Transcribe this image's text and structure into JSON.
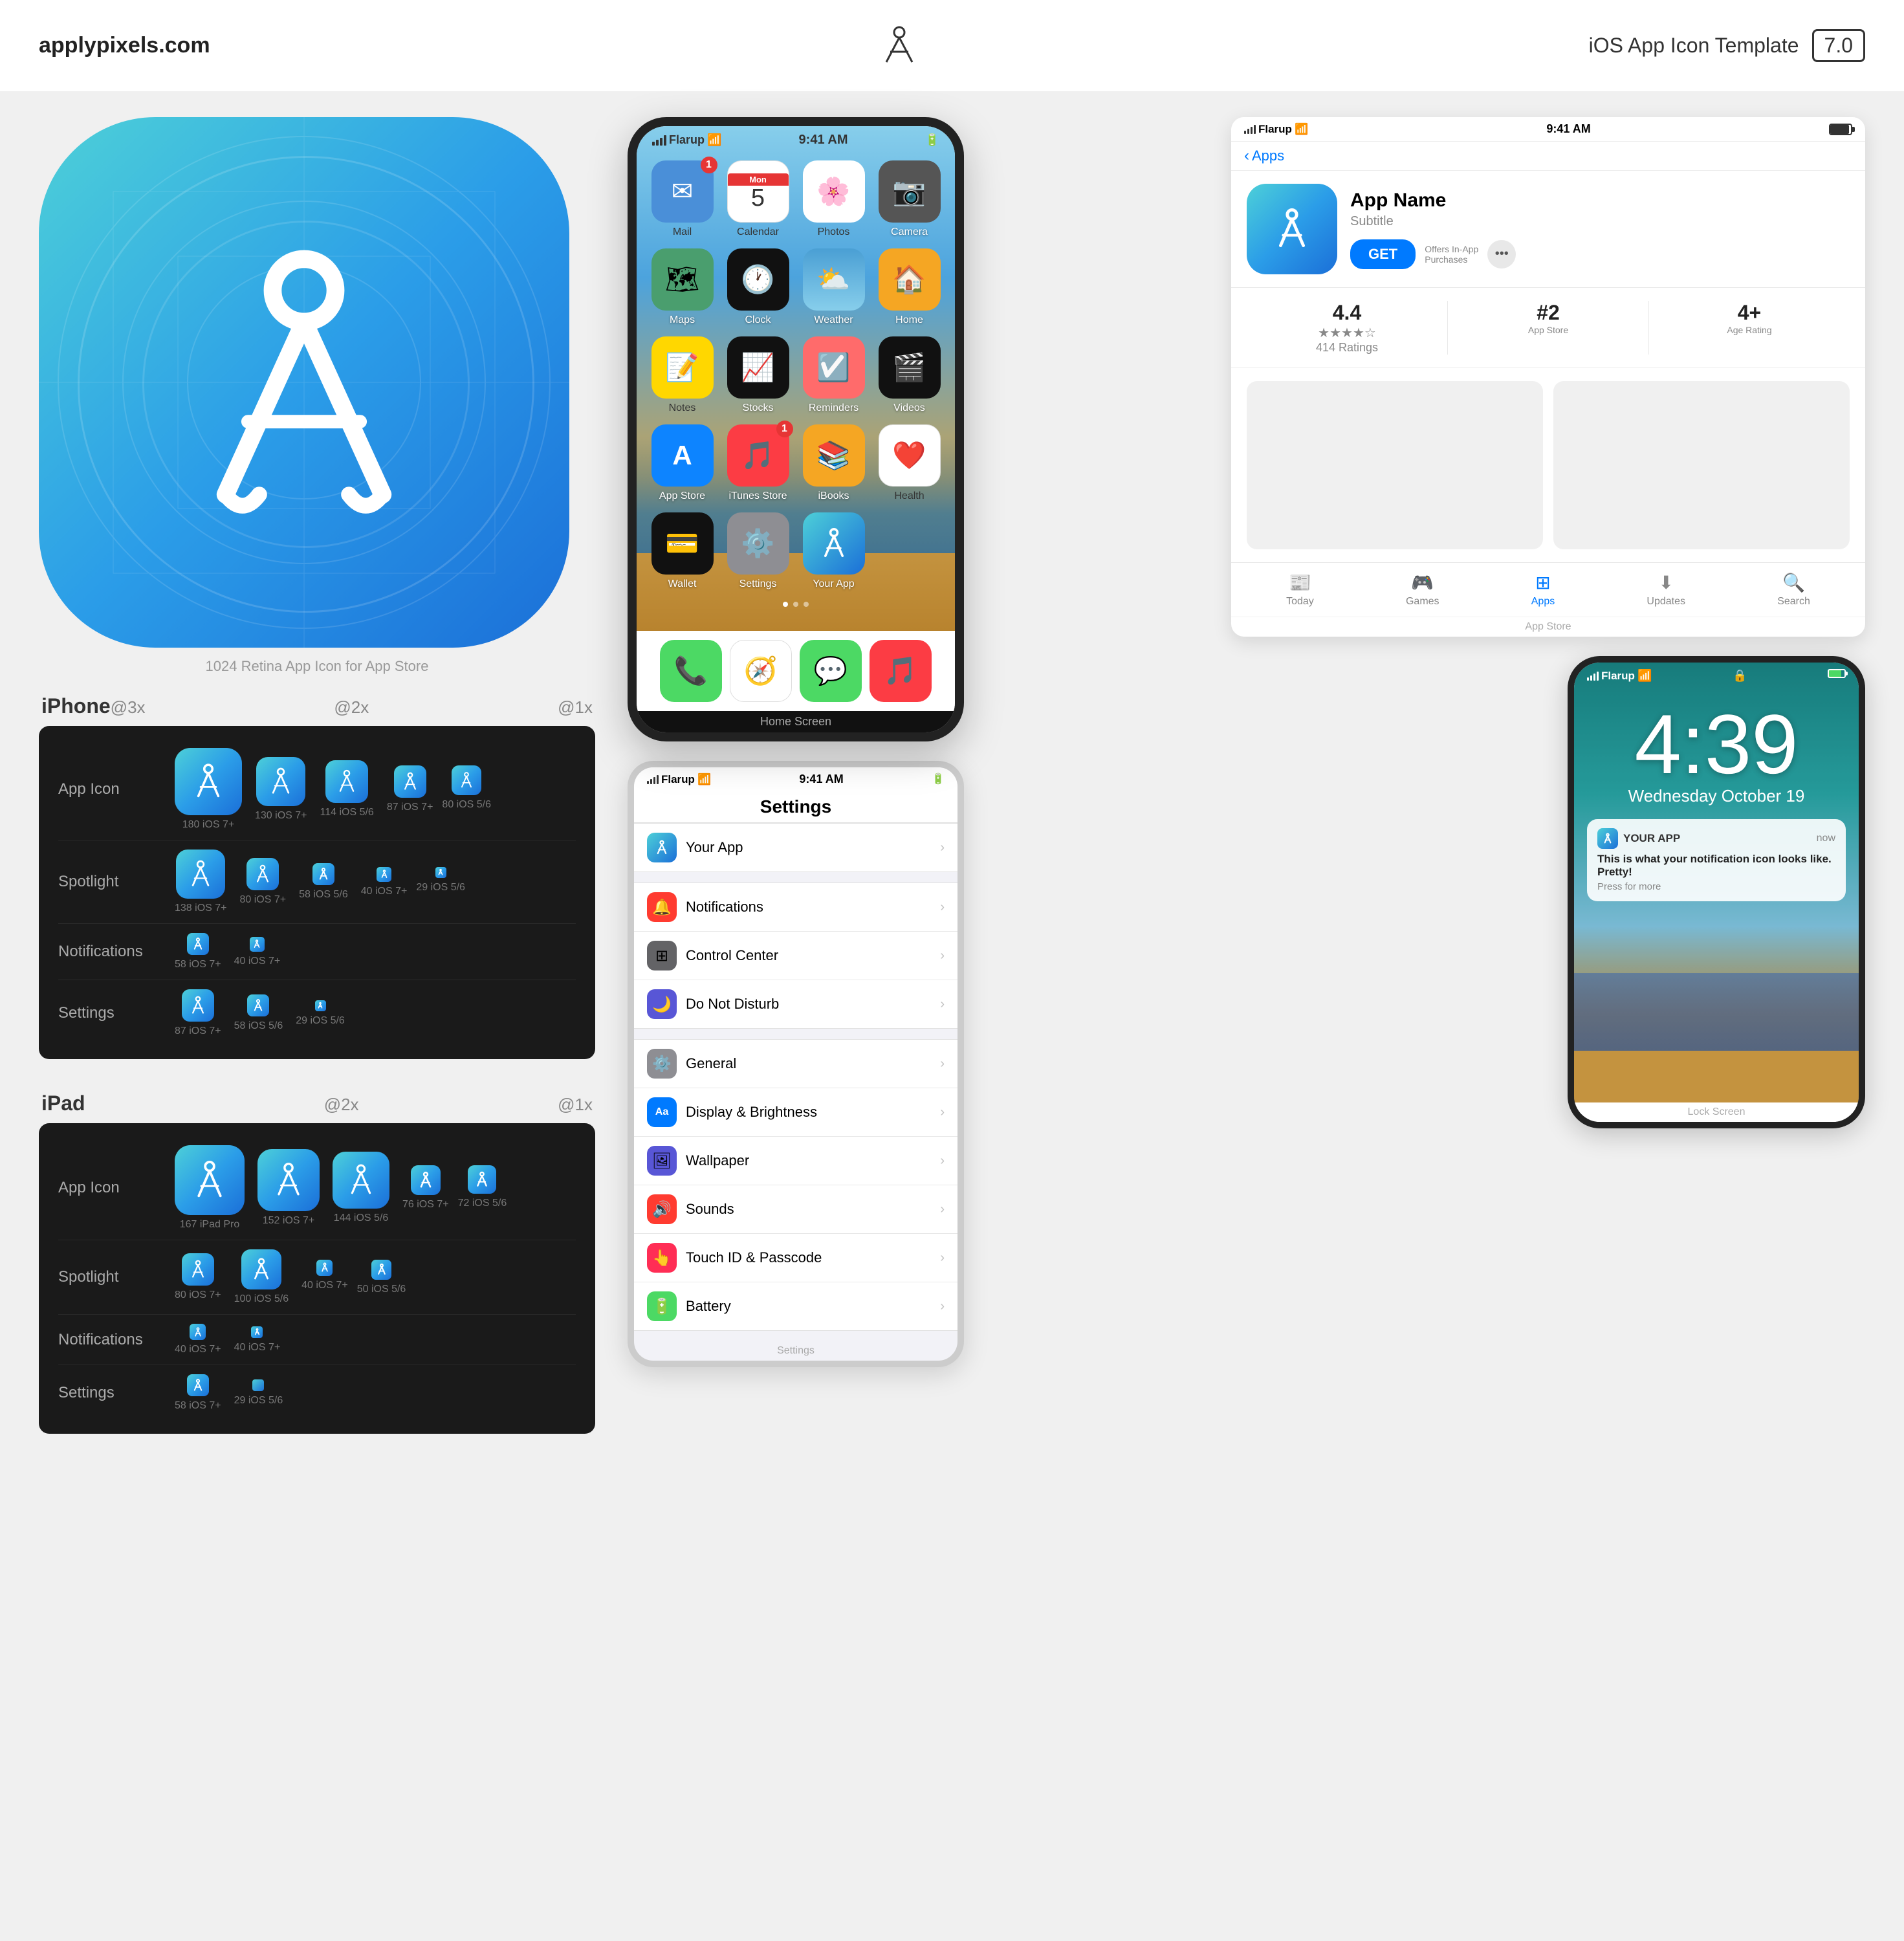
{
  "header": {
    "site": "applypixels.com",
    "template_label": "iOS App Icon Template",
    "version": "7.0"
  },
  "large_icon_label": "1024 Retina App Icon for App Store",
  "iphone": {
    "title": "iPhone",
    "scales": {
      "s3x": "@3x",
      "s2x": "@2x",
      "s1x": "@1x"
    },
    "rows": [
      {
        "label": "App Icon",
        "items": [
          {
            "size": 180,
            "label": "180 iOS 7+",
            "scale": "3x"
          },
          {
            "size": 130,
            "label": "130 iOS 7+",
            "scale": "2x"
          },
          {
            "size": 114,
            "label": "114 iOS 5/6",
            "scale": "2x"
          },
          {
            "size": 87,
            "label": "87 iOS 7+",
            "scale": "1x"
          },
          {
            "size": 80,
            "label": "80 iOS 5/6",
            "scale": "1x"
          }
        ]
      },
      {
        "label": "Spotlight",
        "items": [
          {
            "size": 138,
            "label": "138 iOS 7+",
            "scale": "3x"
          },
          {
            "size": 80,
            "label": "80 iOS 7+",
            "scale": "2x"
          },
          {
            "size": 58,
            "label": "58 iOS 5/6",
            "scale": "2x"
          },
          {
            "size": 40,
            "label": "40 iOS 7+",
            "scale": "1x"
          },
          {
            "size": 29,
            "label": "29 iOS 5/6",
            "scale": "1x"
          }
        ]
      },
      {
        "label": "Notifications",
        "items": [
          {
            "size": 58,
            "label": "58 iOS 7+",
            "scale": "2x"
          },
          {
            "size": 40,
            "label": "40 iOS 7+",
            "scale": "1x"
          }
        ]
      },
      {
        "label": "Settings",
        "items": [
          {
            "size": 87,
            "label": "87 iOS 7+",
            "scale": "3x"
          },
          {
            "size": 58,
            "label": "58 iOS 5/6",
            "scale": "2x"
          },
          {
            "size": 29,
            "label": "29 iOS 5/6",
            "scale": "1x"
          }
        ]
      }
    ]
  },
  "ipad": {
    "title": "iPad",
    "scales": {
      "s2x": "@2x",
      "s1x": "@1x"
    },
    "rows": [
      {
        "label": "App Icon",
        "items": [
          {
            "size": 167,
            "label": "167 iPad Pro",
            "scale": "2x"
          },
          {
            "size": 152,
            "label": "152 iOS 7+",
            "scale": "2x"
          },
          {
            "size": 144,
            "label": "144 iOS 5/6",
            "scale": "2x"
          },
          {
            "size": 76,
            "label": "76 iOS 7+",
            "scale": "1x"
          },
          {
            "size": 72,
            "label": "72 iOS 5/6",
            "scale": "1x"
          }
        ]
      },
      {
        "label": "Spotlight",
        "items": [
          {
            "size": 80,
            "label": "80 iOS 7+",
            "scale": "2x"
          },
          {
            "size": 100,
            "label": "100 iOS 5/6",
            "scale": "2x"
          },
          {
            "size": 40,
            "label": "40 iOS 7+",
            "scale": "1x"
          },
          {
            "size": 50,
            "label": "50 iOS 5/6",
            "scale": "1x"
          }
        ]
      },
      {
        "label": "Notifications",
        "items": [
          {
            "size": 40,
            "label": "40 iOS 7+",
            "scale": "2x"
          },
          {
            "size": 40,
            "label": "40 iOS 7+",
            "scale": "1x"
          }
        ]
      },
      {
        "label": "Settings",
        "items": [
          {
            "size": 58,
            "label": "58 iOS 7+",
            "scale": "2x"
          },
          {
            "size": 29,
            "label": "29 iOS 5/6",
            "scale": "1x"
          }
        ]
      }
    ]
  },
  "phone_screen": {
    "status_left": "Flarup",
    "status_center": "9:41 AM",
    "status_right": "battery",
    "label": "Home Screen",
    "apps": [
      {
        "name": "Mail",
        "color": "#4a8fd8",
        "badge": "1",
        "emoji": "✉️"
      },
      {
        "name": "Calendar",
        "color": "#ffffff",
        "emoji": "📅",
        "day": "5"
      },
      {
        "name": "Photos",
        "color": "#ffffff",
        "emoji": "🌸"
      },
      {
        "name": "Camera",
        "color": "#555555",
        "emoji": "📷"
      },
      {
        "name": "Maps",
        "color": "#4a9e6e",
        "emoji": "🗺️"
      },
      {
        "name": "Clock",
        "color": "#111111",
        "emoji": "🕐"
      },
      {
        "name": "Weather",
        "color": "#4a9fd4",
        "emoji": "☁️"
      },
      {
        "name": "Home",
        "color": "#f5a623",
        "emoji": "🏠"
      },
      {
        "name": "Notes",
        "color": "#ffd700",
        "emoji": "📝"
      },
      {
        "name": "Stocks",
        "color": "#111111",
        "emoji": "📈"
      },
      {
        "name": "Reminders",
        "color": "#ff6b6b",
        "emoji": "📋"
      },
      {
        "name": "Videos",
        "color": "#111111",
        "emoji": "🎬"
      },
      {
        "name": "App Store",
        "color": "#0d84ff",
        "emoji": "🅐"
      },
      {
        "name": "iTunes Store",
        "color": "#fc3c44",
        "emoji": "🎵",
        "badge": "1"
      },
      {
        "name": "iBooks",
        "color": "#f5a623",
        "emoji": "📚"
      },
      {
        "name": "Health",
        "color": "#ffffff",
        "emoji": "❤️"
      },
      {
        "name": "Wallet",
        "color": "#111111",
        "emoji": "💳"
      },
      {
        "name": "Settings",
        "color": "#8e8e93",
        "emoji": "⚙️"
      },
      {
        "name": "Your App",
        "color": "gradient",
        "emoji": "✏️"
      }
    ],
    "dock": [
      {
        "name": "Phone",
        "color": "#4cd964",
        "emoji": "📞"
      },
      {
        "name": "Safari",
        "color": "#ffffff",
        "emoji": "🧭"
      },
      {
        "name": "Messages",
        "color": "#4cd964",
        "emoji": "💬"
      },
      {
        "name": "Music",
        "color": "#fc3c44",
        "emoji": "🎵"
      }
    ]
  },
  "settings_screen": {
    "status_left": "Flarup",
    "status_center": "9:41 AM",
    "title": "Settings",
    "your_app": "Your App",
    "items": [
      {
        "name": "Notifications",
        "icon_color": "#ff3b30",
        "icon": "🔔"
      },
      {
        "name": "Control Center",
        "icon_color": "#636366",
        "icon": "🔲"
      },
      {
        "name": "Do Not Disturb",
        "icon_color": "#5856d6",
        "icon": "🌙"
      },
      {
        "name": "General",
        "icon_color": "#8e8e93",
        "icon": "⚙️"
      },
      {
        "name": "Display & Brightness",
        "icon_color": "#007aff",
        "icon": "Aa"
      },
      {
        "name": "Wallpaper",
        "icon_color": "#5856d6",
        "icon": "🖼️"
      },
      {
        "name": "Sounds",
        "icon_color": "#ff3b30",
        "icon": "🔊"
      },
      {
        "name": "Touch ID & Passcode",
        "icon_color": "#ff2d55",
        "icon": "👆"
      },
      {
        "name": "Battery",
        "icon_color": "#4cd964",
        "icon": "🔋"
      }
    ],
    "label": "Settings"
  },
  "appstore": {
    "status_left": "Flarup",
    "status_center": "9:41 AM",
    "status_right": "battery",
    "back_label": "Apps",
    "app_name": "App Name",
    "subtitle": "Subtitle",
    "get_label": "GET",
    "in_app_label": "Offers In-App\nPurchases",
    "rating": "4.4",
    "rating_count": "414 Ratings",
    "rank": "#2",
    "rank_label": "App Store",
    "age": "4+",
    "age_label": "Age Rating",
    "nav": [
      "Today",
      "Games",
      "Apps",
      "Updates",
      "Search"
    ],
    "active_nav": "Apps",
    "footer": "App Store"
  },
  "lockscreen": {
    "status_left": "Flarup",
    "status_right": "battery",
    "time": "4:39",
    "date": "Wednesday October 19",
    "notif_app": "YOUR APP",
    "notif_time": "now",
    "notif_title": "This is what your notification icon looks like. Pretty!",
    "notif_more": "Press for more",
    "label": "Lock Screen"
  },
  "colors": {
    "accent": "#007aff",
    "destructive": "#ff3b30",
    "gradient_start": "#4dd0d8",
    "gradient_end": "#1b6fd8"
  }
}
